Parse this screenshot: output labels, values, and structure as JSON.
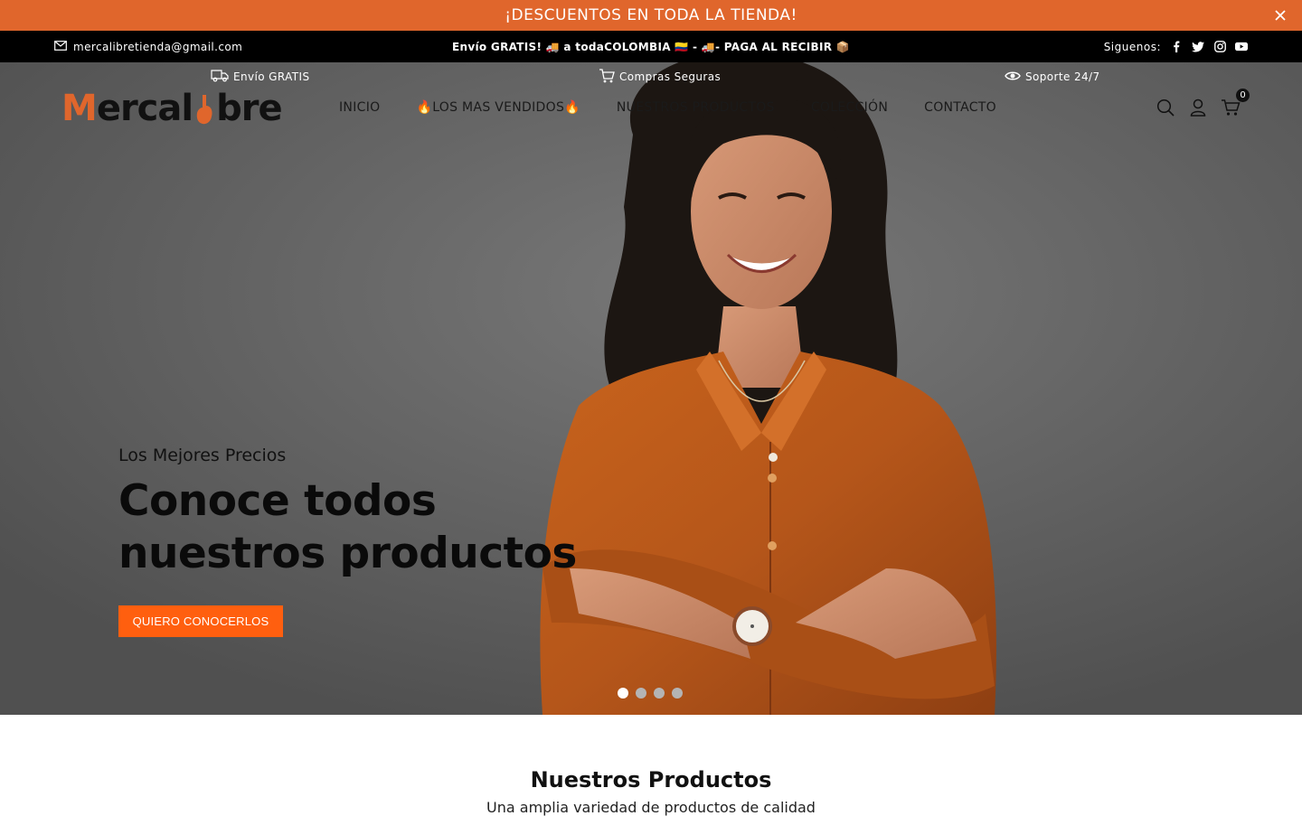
{
  "promo": {
    "text": "¡DESCUENTOS EN TODA LA TIENDA!"
  },
  "infobar": {
    "email": "mercalibretienda@gmail.com",
    "shipping": "Envío GRATIS! 🚚 a todaCOLOMBIA 🇨🇴 - 🚚- PAGA AL RECIBIR 📦",
    "social_label": "Siguenos:",
    "social_icons": [
      "facebook-icon",
      "twitter-icon",
      "instagram-icon",
      "youtube-icon"
    ]
  },
  "features": {
    "shipping": "Envío GRATIS",
    "secure": "Compras Seguras",
    "support": "Soporte 24/7"
  },
  "header": {
    "logo_m": "M",
    "logo_rest": "ercal",
    "logo_end": "bre",
    "menu": [
      "INICIO",
      "🔥LOS MAS VENDIDOS🔥",
      "NUESTROS PRODUCTOS",
      "COLECCIÓN",
      "CONTACTO"
    ],
    "cart_count": "0"
  },
  "hero": {
    "subtitle": "Los Mejores Precios",
    "title": "Conoce todos nuestros productos",
    "button": "QUIERO CONOCERLOS",
    "slides": 4,
    "active_slide": 0
  },
  "section": {
    "title": "Nuestros Productos",
    "subtitle": "Una amplia variedad de productos de calidad"
  },
  "colors": {
    "brand_orange": "#e0662c",
    "button_orange": "#ff5f0f",
    "infobar_bg": "#000000"
  }
}
